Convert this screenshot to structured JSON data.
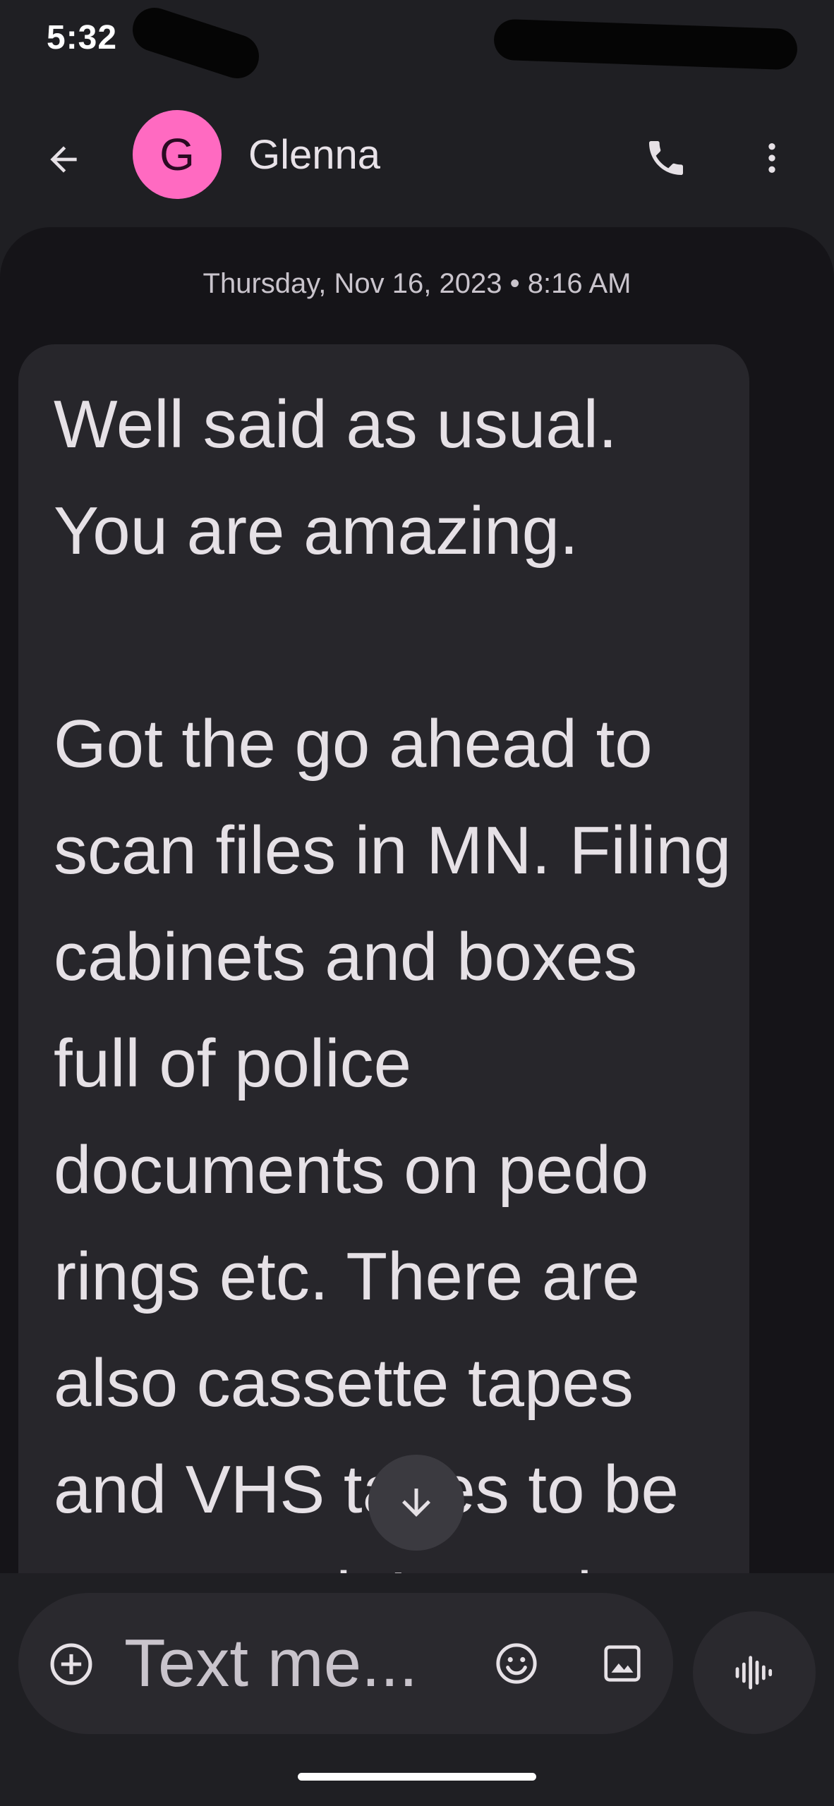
{
  "status_bar": {
    "time": "5:32"
  },
  "header": {
    "avatar_letter": "G",
    "contact_name": "Glenna",
    "avatar_color": "#ff6ac1"
  },
  "conversation": {
    "timestamp": "Thursday, Nov 16, 2023 • 8:16 AM",
    "message": {
      "text": "Well said as usual.\nYou are amazing.\n\nGot the go ahead to scan files in MN. Filing cabinets and boxes full of police documents on pedo rings etc. There are also cassette tapes and VHS tapes to be converted. I can do"
    }
  },
  "compose": {
    "placeholder": "Text me..."
  },
  "icons": {
    "back": "arrow-back-icon",
    "call": "phone-icon",
    "more": "more-vert-icon",
    "scroll": "arrow-down-icon",
    "add": "add-circle-icon",
    "emoji": "emoji-icon",
    "gallery": "image-icon",
    "voice": "voice-waveform-icon"
  }
}
